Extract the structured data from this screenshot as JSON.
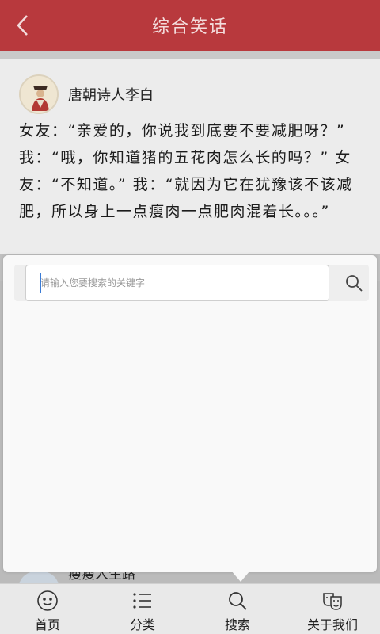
{
  "header": {
    "title": "综合笑话",
    "back_icon": "back-arrow-icon"
  },
  "post": {
    "author": "唐朝诗人李白",
    "content": "女友：“亲爱的，你说我到底要不要减肥呀？” 我：“哦，你知道猪的五花肉怎么长的吗？” 女友：“不知道。” 我：“就因为它在犹豫该不该减肥，所以身上一点瘦肉一点肥肉混着长。。。”"
  },
  "search": {
    "placeholder": "请输入您要搜索的关键字",
    "value": "",
    "button_icon": "search-icon"
  },
  "next_post": {
    "author": "瘦瘦人生路"
  },
  "tabbar": {
    "items": [
      {
        "label": "首页",
        "icon": "smiley-face-icon"
      },
      {
        "label": "分类",
        "icon": "list-icon"
      },
      {
        "label": "搜索",
        "icon": "search-icon"
      },
      {
        "label": "关于我们",
        "icon": "masks-icon"
      }
    ]
  },
  "colors": {
    "header": "#b8393d",
    "background": "#ececec",
    "popup": "#f9f9f9"
  }
}
